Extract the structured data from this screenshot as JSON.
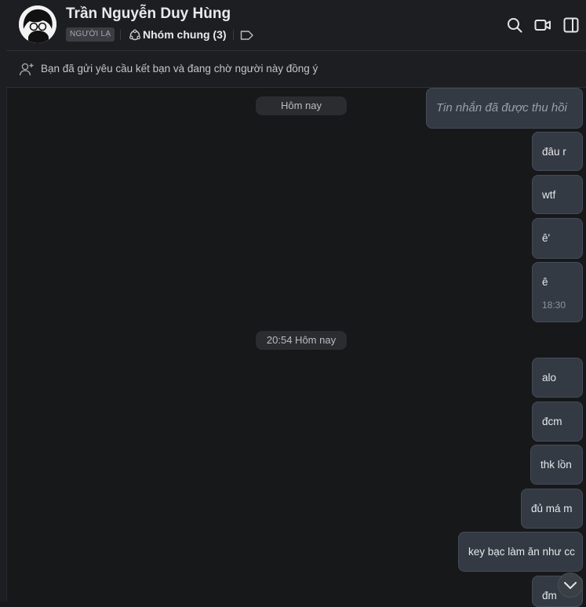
{
  "header": {
    "name": "Trần Nguyễn Duy Hùng",
    "stranger_tag": "NGƯỜI LẠ",
    "group_label": "Nhóm chung (3)"
  },
  "banner": {
    "text": "Bạn đã gửi yêu cầu kết bạn và đang chờ người này đồng ý"
  },
  "dates": {
    "first": "Hôm nay",
    "second": "20:54 Hôm nay"
  },
  "messages": [
    {
      "text": "Tin nhắn đã được thu hồi",
      "recalled": true
    },
    {
      "text": "đâu r"
    },
    {
      "text": "wtf"
    },
    {
      "text": "ê'"
    },
    {
      "text": "ê",
      "time": "18:30"
    },
    {
      "text": "alo"
    },
    {
      "text": "đcm"
    },
    {
      "text": "thk lồn"
    },
    {
      "text": "đủ má m"
    },
    {
      "text": "key bạc làm ăn như cc"
    },
    {
      "text": "đm"
    }
  ],
  "icons": {
    "search": "search-icon",
    "video": "video-call-icon",
    "panel": "toggle-panel-icon",
    "group": "group-icon",
    "label": "tag-icon",
    "add_friend": "add-friend-icon",
    "scroll_down": "chevron-down-icon"
  }
}
